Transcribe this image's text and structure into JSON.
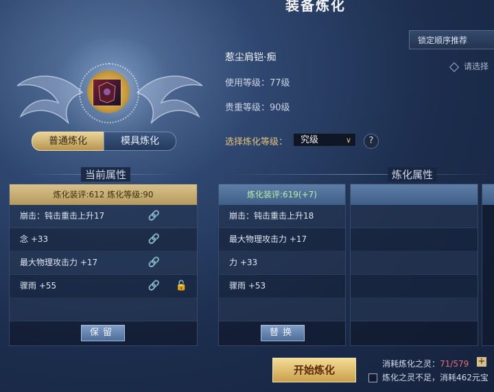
{
  "window": {
    "title": "装备炼化"
  },
  "tabs": [
    {
      "label": "普通炼化",
      "active": true
    },
    {
      "label": "模具炼化",
      "active": false
    }
  ],
  "item": {
    "name": "惹尘肩铠·痴",
    "use_level": "使用等级：77级",
    "noble_level": "贵重等级：90级"
  },
  "refine_level": {
    "label": "选择炼化等级：",
    "value": "究级",
    "help": "?"
  },
  "recommend": {
    "label": "锁定顺序推荐",
    "hint": "请选择"
  },
  "current": {
    "section_title": "当前属性",
    "header": "炼化装评:612  炼化等级:90",
    "rows": [
      {
        "text": "崩击：钝击重击上升17",
        "link": "on"
      },
      {
        "text": "念 +33",
        "link": "dim"
      },
      {
        "text": "最大物理攻击力 +17",
        "link": "on"
      },
      {
        "text": "骤雨 +55",
        "link": "on",
        "padlock": true
      },
      {
        "text": ""
      }
    ],
    "button": "保留"
  },
  "refine": {
    "section_title": "炼化属性",
    "header": "炼化装评:619(+7)",
    "rows": [
      {
        "text": "崩击：钝击重击上升18"
      },
      {
        "text": "最大物理攻击力 +17"
      },
      {
        "text": "力 +33"
      },
      {
        "text": "骤雨 +53"
      },
      {
        "text": ""
      }
    ],
    "button": "替换"
  },
  "bottom": {
    "start_button": "开始炼化",
    "cost_label": "消耗炼化之灵：",
    "cost_value": "71/579",
    "plus": "+",
    "warning": "炼化之灵不足，消耗462元宝"
  },
  "icons": {
    "link": "chain-link-icon",
    "padlock": "padlock-open-icon",
    "chevron": "chevron-down-icon"
  }
}
